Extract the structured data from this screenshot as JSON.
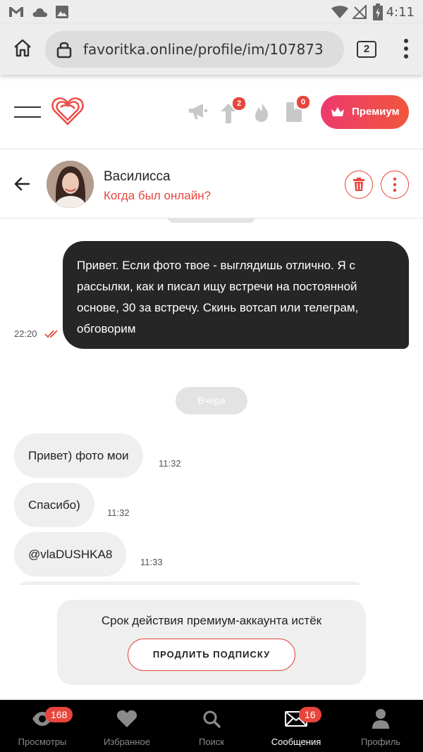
{
  "status_bar": {
    "time": "4:11"
  },
  "browser": {
    "url": "favoritka.online/profile/im/107873",
    "tab_count": "2"
  },
  "header": {
    "boost_badge": "2",
    "gifts_badge": "0",
    "premium_label": "Премиум",
    "accent_color": "#e8453c"
  },
  "chat": {
    "contact_name": "Василисса",
    "contact_status": "Когда был онлайн?"
  },
  "messages": {
    "outgoing": [
      {
        "line1": "Привет. Если фото твое - выглядишь отлично. Я с",
        "line2": "рассылки, как и писал ищу встречи на постоянной",
        "line3": "основе, 30 за встречу. Скинь вотсап или телеграм,",
        "line4": "обговорим",
        "time": "22:20"
      }
    ],
    "date_separator": "Вчера",
    "incoming": [
      {
        "text": "Привет) фото мои",
        "time": "11:32"
      },
      {
        "text": "Спасибо)",
        "time": "11:32"
      },
      {
        "text": "@vlaDUSHKA8",
        "time": "11:33"
      }
    ]
  },
  "premium_notice": {
    "title": "Срок действия премиум-аккаунта истёк",
    "button": "ПРОДЛИТЬ ПОДПИСКУ"
  },
  "bottom_nav": [
    {
      "label": "Просмотры",
      "badge": "168",
      "icon": "eye-icon"
    },
    {
      "label": "Избранное",
      "icon": "heart-icon"
    },
    {
      "label": "Поиск",
      "icon": "search-icon"
    },
    {
      "label": "Сообщения",
      "badge": "16",
      "icon": "envelope-icon",
      "active": true
    },
    {
      "label": "Профиль",
      "icon": "user-icon"
    }
  ]
}
